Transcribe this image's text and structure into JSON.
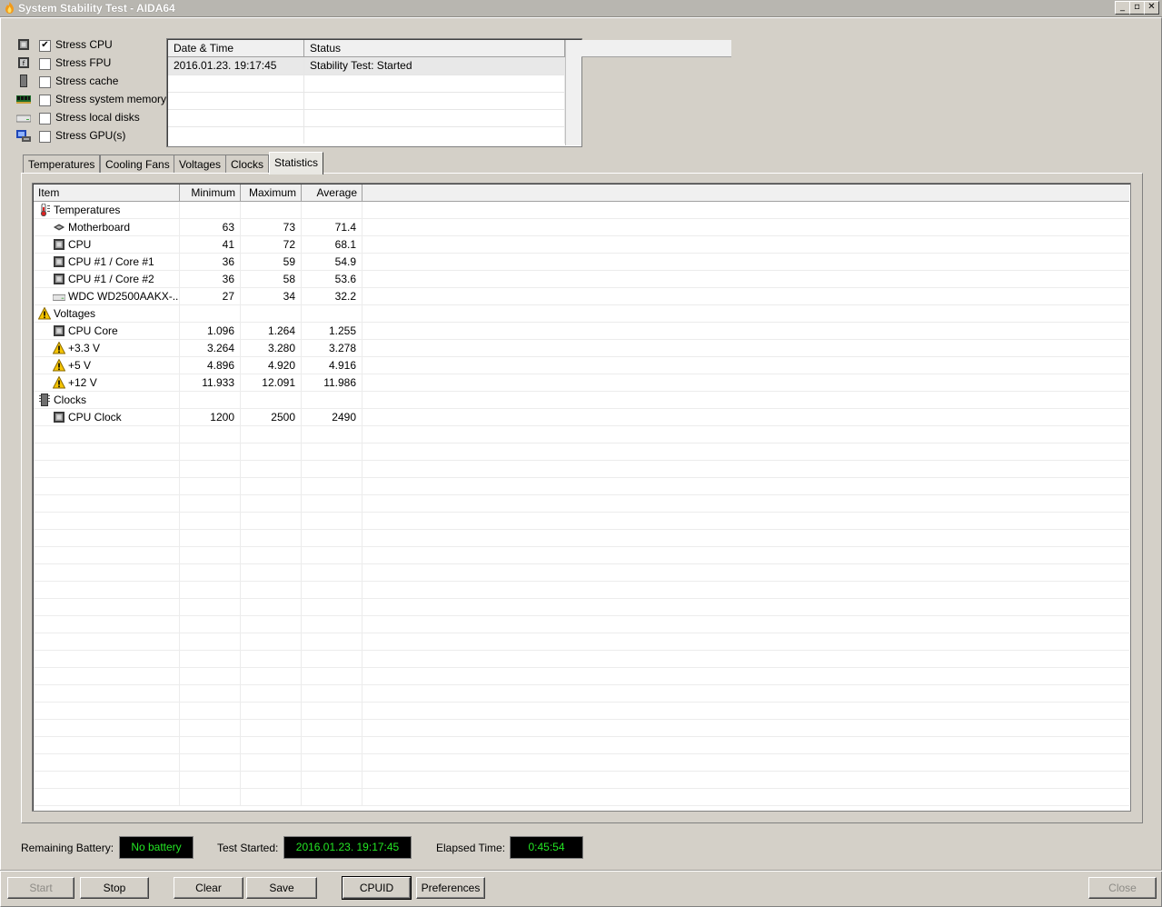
{
  "window": {
    "title": "System Stability Test - AIDA64",
    "min_glyph": "_",
    "max_glyph": "▫",
    "close_glyph": "✕"
  },
  "stress": [
    {
      "label": "Stress CPU",
      "checked": true,
      "icon": "cpu-icon"
    },
    {
      "label": "Stress FPU",
      "checked": false,
      "icon": "fpu-icon"
    },
    {
      "label": "Stress cache",
      "checked": false,
      "icon": "cache-icon"
    },
    {
      "label": "Stress system memory",
      "checked": false,
      "icon": "memory-icon"
    },
    {
      "label": "Stress local disks",
      "checked": false,
      "icon": "disk-icon"
    },
    {
      "label": "Stress GPU(s)",
      "checked": false,
      "icon": "gpu-icon"
    }
  ],
  "log": {
    "headers": [
      "Date & Time",
      "Status"
    ],
    "rows": [
      {
        "date": "2016.01.23. 19:17:45",
        "status": "Stability Test: Started"
      }
    ]
  },
  "tabs": [
    "Temperatures",
    "Cooling Fans",
    "Voltages",
    "Clocks",
    "Statistics"
  ],
  "active_tab": "Statistics",
  "stats": {
    "headers": [
      "Item",
      "Minimum",
      "Maximum",
      "Average"
    ],
    "rows": [
      {
        "kind": "group",
        "icon": "thermometer-icon",
        "item": "Temperatures",
        "min": "",
        "max": "",
        "avg": ""
      },
      {
        "kind": "item",
        "icon": "motherboard-icon",
        "item": "Motherboard",
        "min": "63",
        "max": "73",
        "avg": "71.4"
      },
      {
        "kind": "item",
        "icon": "cpu-icon",
        "item": "CPU",
        "min": "41",
        "max": "72",
        "avg": "68.1"
      },
      {
        "kind": "item",
        "icon": "cpu-icon",
        "item": "CPU #1 / Core #1",
        "min": "36",
        "max": "59",
        "avg": "54.9"
      },
      {
        "kind": "item",
        "icon": "cpu-icon",
        "item": "CPU #1 / Core #2",
        "min": "36",
        "max": "58",
        "avg": "53.6"
      },
      {
        "kind": "item",
        "icon": "disk-icon",
        "item": "WDC WD2500AAKX-...",
        "min": "27",
        "max": "34",
        "avg": "32.2"
      },
      {
        "kind": "group",
        "icon": "warning-icon",
        "item": "Voltages",
        "min": "",
        "max": "",
        "avg": ""
      },
      {
        "kind": "item",
        "icon": "cpu-icon",
        "item": "CPU Core",
        "min": "1.096",
        "max": "1.264",
        "avg": "1.255"
      },
      {
        "kind": "item",
        "icon": "warning-icon",
        "item": "+3.3 V",
        "min": "3.264",
        "max": "3.280",
        "avg": "3.278"
      },
      {
        "kind": "item",
        "icon": "warning-icon",
        "item": "+5 V",
        "min": "4.896",
        "max": "4.920",
        "avg": "4.916"
      },
      {
        "kind": "item",
        "icon": "warning-icon",
        "item": "+12 V",
        "min": "11.933",
        "max": "12.091",
        "avg": "11.986"
      },
      {
        "kind": "group",
        "icon": "clock-chip-icon",
        "item": "Clocks",
        "min": "",
        "max": "",
        "avg": ""
      },
      {
        "kind": "item",
        "icon": "cpu-icon",
        "item": "CPU Clock",
        "min": "1200",
        "max": "2500",
        "avg": "2490"
      }
    ]
  },
  "status": {
    "battery_label": "Remaining Battery:",
    "battery_value": "No battery",
    "started_label": "Test Started:",
    "started_value": "2016.01.23. 19:17:45",
    "elapsed_label": "Elapsed Time:",
    "elapsed_value": "0:45:54",
    "value_color": "#23e623"
  },
  "buttons": {
    "start": "Start",
    "stop": "Stop",
    "clear": "Clear",
    "save": "Save",
    "cpuid": "CPUID",
    "preferences": "Preferences",
    "close": "Close"
  }
}
